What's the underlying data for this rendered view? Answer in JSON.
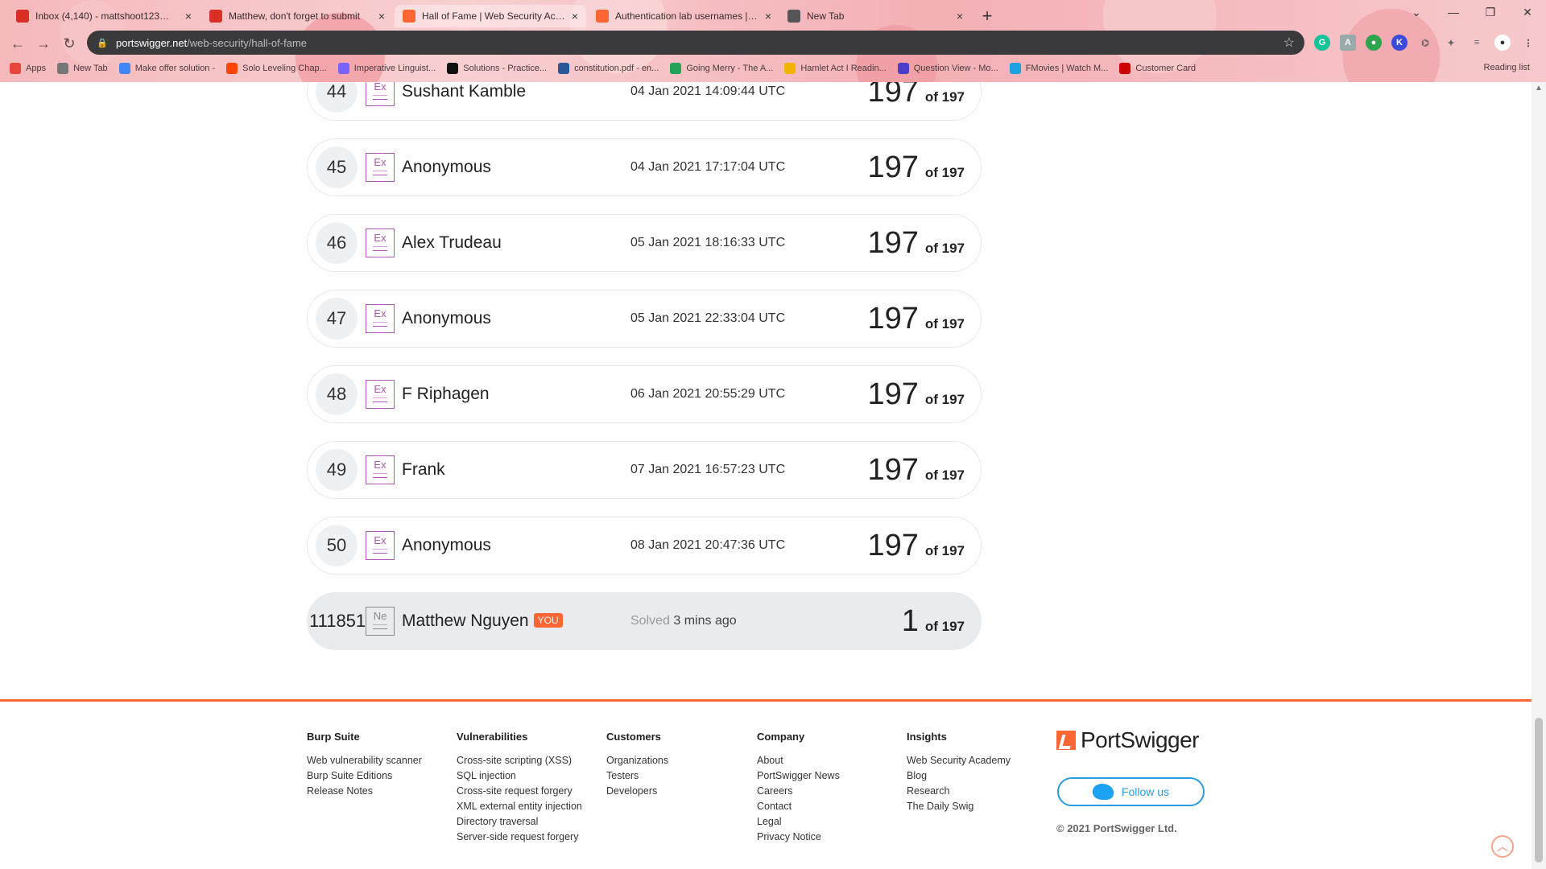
{
  "browser": {
    "tabs": [
      {
        "title": "Inbox (4,140) - mattshoot123@gm",
        "favicon": "gmail-icon",
        "color": "#d93025"
      },
      {
        "title": "Matthew, don't forget to submit",
        "favicon": "gmail-icon",
        "color": "#d93025"
      },
      {
        "title": "Hall of Fame | Web Security Acade",
        "favicon": "portswigger-icon",
        "color": "#ff6633"
      },
      {
        "title": "Authentication lab usernames | W",
        "favicon": "portswigger-icon",
        "color": "#ff6633"
      },
      {
        "title": "New Tab",
        "favicon": "chrome-icon",
        "color": "#555555"
      }
    ],
    "url_host": "portswigger.net",
    "url_path": "/web-security/hall-of-fame",
    "bookmarks": [
      {
        "label": "Apps",
        "color": "#e8453c"
      },
      {
        "label": "New Tab",
        "color": "#777777"
      },
      {
        "label": "Make offer solution -",
        "color": "#4285f4"
      },
      {
        "label": "Solo Leveling Chap...",
        "color": "#ff4500"
      },
      {
        "label": "Imperative Linguist...",
        "color": "#7b61ff"
      },
      {
        "label": "Solutions - Practice...",
        "color": "#111111"
      },
      {
        "label": "constitution.pdf - en...",
        "color": "#2b5797"
      },
      {
        "label": "Going Merry - The A...",
        "color": "#21a35a"
      },
      {
        "label": "Hamlet Act I Readin...",
        "color": "#f2b400"
      },
      {
        "label": "Question View - Mo...",
        "color": "#4b3fc9"
      },
      {
        "label": "FMovies | Watch M...",
        "color": "#1fa0e0"
      },
      {
        "label": "Customer Card",
        "color": "#cc0000"
      }
    ],
    "reading_list": "Reading list"
  },
  "leaderboard": [
    {
      "rank": "44",
      "level": "Ex",
      "name": "Sushant Kamble",
      "date": "04 Jan 2021 14:09:44 UTC",
      "score": "197",
      "of": "of 197"
    },
    {
      "rank": "45",
      "level": "Ex",
      "name": "Anonymous",
      "date": "04 Jan 2021 17:17:04 UTC",
      "score": "197",
      "of": "of 197"
    },
    {
      "rank": "46",
      "level": "Ex",
      "name": "Alex Trudeau",
      "date": "05 Jan 2021 18:16:33 UTC",
      "score": "197",
      "of": "of 197"
    },
    {
      "rank": "47",
      "level": "Ex",
      "name": "Anonymous",
      "date": "05 Jan 2021 22:33:04 UTC",
      "score": "197",
      "of": "of 197"
    },
    {
      "rank": "48",
      "level": "Ex",
      "name": "F Riphagen",
      "date": "06 Jan 2021 20:55:29 UTC",
      "score": "197",
      "of": "of 197"
    },
    {
      "rank": "49",
      "level": "Ex",
      "name": "Frank",
      "date": "07 Jan 2021 16:57:23 UTC",
      "score": "197",
      "of": "of 197"
    },
    {
      "rank": "50",
      "level": "Ex",
      "name": "Anonymous",
      "date": "08 Jan 2021 20:47:36 UTC",
      "score": "197",
      "of": "of 197"
    }
  ],
  "you_row": {
    "rank": "111851",
    "level": "Ne",
    "name": "Matthew Nguyen",
    "badge": "YOU",
    "solved_prefix": "Solved",
    "solved_time": "3 mins ago",
    "score": "1",
    "of": "of 197"
  },
  "footer": {
    "columns": [
      {
        "heading": "Burp Suite",
        "links": [
          "Web vulnerability scanner",
          "Burp Suite Editions",
          "Release Notes"
        ]
      },
      {
        "heading": "Vulnerabilities",
        "links": [
          "Cross-site scripting (XSS)",
          "SQL injection",
          "Cross-site request forgery",
          "XML external entity injection",
          "Directory traversal",
          "Server-side request forgery"
        ]
      },
      {
        "heading": "Customers",
        "links": [
          "Organizations",
          "Testers",
          "Developers"
        ]
      },
      {
        "heading": "Company",
        "links": [
          "About",
          "PortSwigger News",
          "Careers",
          "Contact",
          "Legal",
          "Privacy Notice"
        ]
      },
      {
        "heading": "Insights",
        "links": [
          "Web Security Academy",
          "Blog",
          "Research",
          "The Daily Swig"
        ]
      }
    ],
    "brand": "PortSwigger",
    "follow_label": "Follow us",
    "copyright": "© 2021 PortSwigger Ltd."
  },
  "colors": {
    "accent": "#ff6633",
    "level_expert": "#b455b6",
    "twitter": "#1da1f2"
  }
}
